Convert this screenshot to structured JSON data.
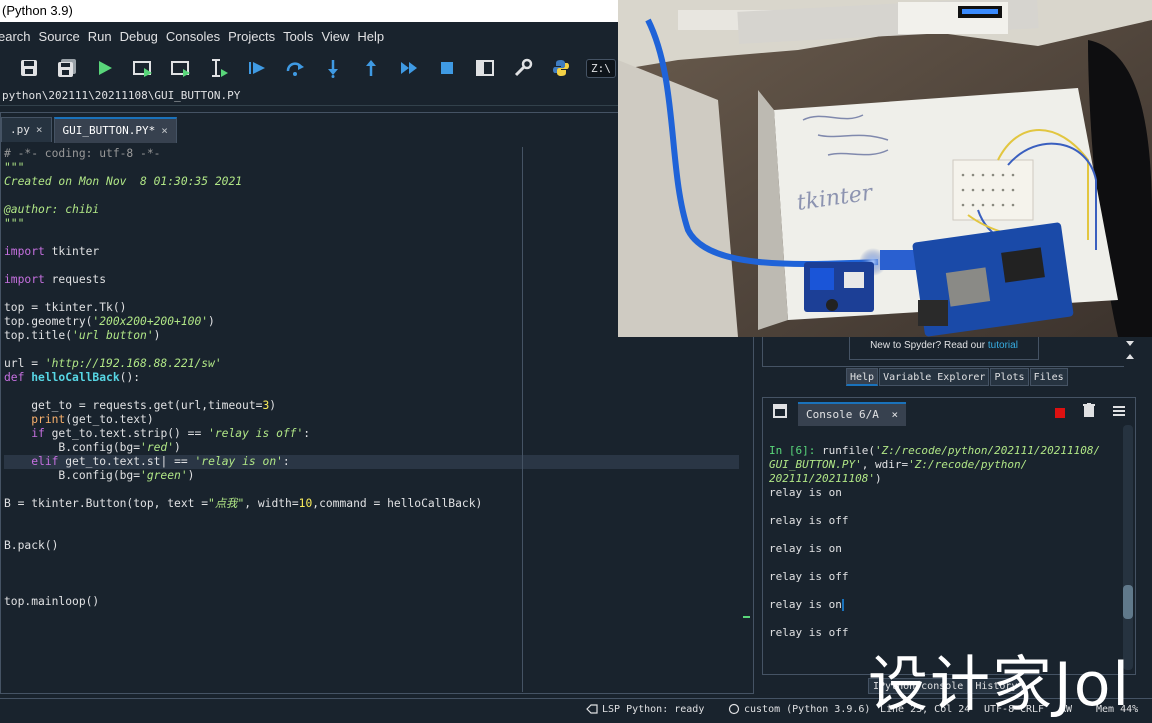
{
  "window": {
    "title": "(Python 3.9)"
  },
  "menu": [
    "earch",
    "Source",
    "Run",
    "Debug",
    "Consoles",
    "Projects",
    "Tools",
    "View",
    "Help"
  ],
  "toolbar": {
    "icons": [
      "save-icon",
      "save-all-icon",
      "run-icon",
      "run-cell-icon",
      "run-cell-advance-icon",
      "run-selection-icon",
      "debug-icon",
      "step-icon",
      "step-into-icon",
      "step-out-icon",
      "continue-icon",
      "stop-icon",
      "maximize-pane-icon",
      "preferences-icon",
      "python-path-icon"
    ],
    "path_box": "Z:\\"
  },
  "editor": {
    "path": "python\\202111\\20211108\\GUI_BUTTON.PY",
    "tabs": [
      {
        "label": ".py",
        "close": "×"
      },
      {
        "label": "GUI_BUTTON.PY*",
        "close": "×"
      }
    ],
    "lines": [
      [
        {
          "t": "# -*- coding: utf-8 -*-",
          "c": "c-com"
        }
      ],
      [
        {
          "t": "\"\"\"",
          "c": "c-str"
        }
      ],
      [
        {
          "t": "Created on Mon Nov  8 01:30:35 2021",
          "c": "c-str"
        }
      ],
      [],
      [
        {
          "t": "@author: chibi",
          "c": "c-str"
        }
      ],
      [
        {
          "t": "\"\"\"",
          "c": "c-str"
        }
      ],
      [],
      [
        {
          "t": "import",
          "c": "c-kw"
        },
        {
          "t": " tkinter",
          "c": "c-pl"
        }
      ],
      [],
      [
        {
          "t": "import",
          "c": "c-kw"
        },
        {
          "t": " requests",
          "c": "c-pl"
        }
      ],
      [],
      [
        {
          "t": "top = tkinter.Tk()",
          "c": "c-pl"
        }
      ],
      [
        {
          "t": "top.geometry(",
          "c": "c-pl"
        },
        {
          "t": "'200x200+200+100'",
          "c": "c-str"
        },
        {
          "t": ")",
          "c": "c-pl"
        }
      ],
      [
        {
          "t": "top.title(",
          "c": "c-pl"
        },
        {
          "t": "'url button'",
          "c": "c-str"
        },
        {
          "t": ")",
          "c": "c-pl"
        }
      ],
      [],
      [
        {
          "t": "url = ",
          "c": "c-pl"
        },
        {
          "t": "'http://192.168.88.221/sw'",
          "c": "c-str"
        }
      ],
      [
        {
          "t": "def",
          "c": "c-kw"
        },
        {
          "t": " ",
          "c": "c-pl"
        },
        {
          "t": "helloCallBack",
          "c": "c-def"
        },
        {
          "t": "():",
          "c": "c-pl"
        }
      ],
      [],
      [
        {
          "t": "    get_to = requests.get(url,timeout=",
          "c": "c-pl"
        },
        {
          "t": "3",
          "c": "c-num"
        },
        {
          "t": ")",
          "c": "c-pl"
        }
      ],
      [
        {
          "t": "    ",
          "c": "c-pl"
        },
        {
          "t": "print",
          "c": "c-bi"
        },
        {
          "t": "(get_to.text)",
          "c": "c-pl"
        }
      ],
      [
        {
          "t": "    ",
          "c": "c-pl"
        },
        {
          "t": "if",
          "c": "c-kw"
        },
        {
          "t": " get_to.text.strip() == ",
          "c": "c-pl"
        },
        {
          "t": "'relay is off'",
          "c": "c-str"
        },
        {
          "t": ":",
          "c": "c-pl"
        }
      ],
      [
        {
          "t": "        B.config(bg=",
          "c": "c-pl"
        },
        {
          "t": "'red'",
          "c": "c-str"
        },
        {
          "t": ")",
          "c": "c-pl"
        }
      ],
      [
        {
          "t": "    ",
          "c": "c-pl"
        },
        {
          "t": "elif",
          "c": "c-kw"
        },
        {
          "t": " get_to.text.st",
          "c": "c-pl"
        },
        {
          "t": "|",
          "c": "c-pl"
        },
        {
          "t": " == ",
          "c": "c-pl"
        },
        {
          "t": "'relay is on'",
          "c": "c-str"
        },
        {
          "t": ":",
          "c": "c-pl"
        }
      ],
      [
        {
          "t": "        B.config(bg=",
          "c": "c-pl"
        },
        {
          "t": "'green'",
          "c": "c-str"
        },
        {
          "t": ")",
          "c": "c-pl"
        }
      ],
      [],
      [
        {
          "t": "B = tkinter.Button(top, text =",
          "c": "c-pl"
        },
        {
          "t": "\"点我\"",
          "c": "c-str"
        },
        {
          "t": ", width=",
          "c": "c-pl"
        },
        {
          "t": "10",
          "c": "c-num"
        },
        {
          "t": ",command = helloCallBack)",
          "c": "c-pl"
        }
      ],
      [],
      [],
      [
        {
          "t": "B.pack()",
          "c": "c-pl"
        }
      ],
      [],
      [],
      [],
      [
        {
          "t": "top.mainloop()",
          "c": "c-pl"
        }
      ]
    ]
  },
  "help": {
    "tutorial_prefix": "New to Spyder? Read our ",
    "tutorial_link": "tutorial"
  },
  "pane_tabs": [
    "Help",
    "Variable Explorer",
    "Plots",
    "Files"
  ],
  "console": {
    "tab": "Console 6/A",
    "tab_close": "×",
    "prompt": "In [6]:",
    "command_1": " runfile(",
    "command_2": "'Z:/recode/python/202111/20211108/",
    "command_3": "GUI_BUTTON.PY'",
    "command_4": ", wdir=",
    "command_5": "'Z:/recode/python/",
    "command_6": "202111/20211108'",
    "command_7": ")",
    "output": [
      "relay is on",
      "",
      "relay is off",
      "",
      "relay is on",
      "",
      "relay is off",
      "",
      "relay is on",
      "",
      "relay is off"
    ]
  },
  "bottom_tabs": [
    "IPython console",
    "History"
  ],
  "status": {
    "lsp": "LSP Python: ready",
    "env": "custom (Python 3.9.6)",
    "position": "Line 23, Col 24",
    "encoding": "UTF-8",
    "eol": "CRLF",
    "rw": "RW",
    "mem": "Mem 44%"
  },
  "photo": {
    "handwriting": "tkinter"
  },
  "watermark": "设计家Jol",
  "colors": {
    "background": "#19232d",
    "accent": "#1a72bb",
    "string": "#b0e686",
    "keyword": "#c670e0"
  }
}
